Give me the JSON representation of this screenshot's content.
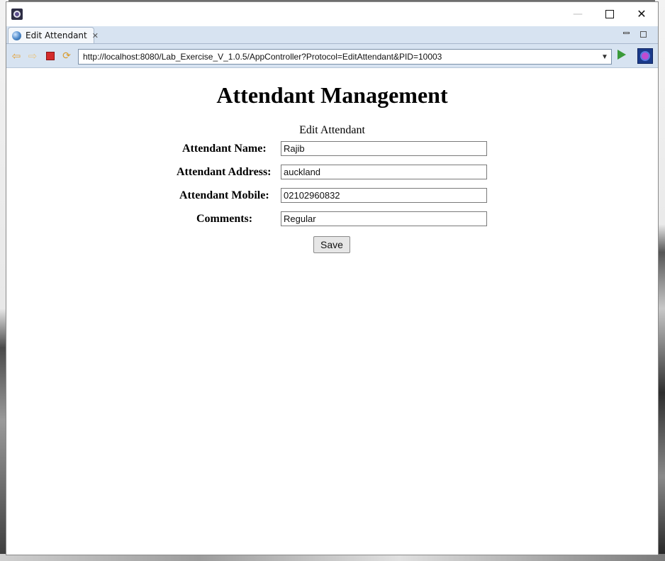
{
  "window": {
    "tab_label": "Edit Attendant",
    "url": "http://localhost:8080/Lab_Exercise_V_1.0.5/AppController?Protocol=EditAttendant&PID=10003"
  },
  "page": {
    "title": "Attendant Management",
    "form_caption": "Edit Attendant",
    "fields": [
      {
        "label": "Attendant Name:",
        "value": "Rajib"
      },
      {
        "label": "Attendant Address:",
        "value": "auckland"
      },
      {
        "label": "Attendant Mobile:",
        "value": "02102960832"
      },
      {
        "label": "Comments:",
        "value": "Regular"
      }
    ],
    "save_label": "Save"
  },
  "icons": [
    "app-icon",
    "globe-icon",
    "close-icon",
    "back-arrow-icon",
    "forward-arrow-icon",
    "stop-icon",
    "refresh-icon",
    "dropdown-icon",
    "go-icon",
    "eclipse-icon"
  ]
}
